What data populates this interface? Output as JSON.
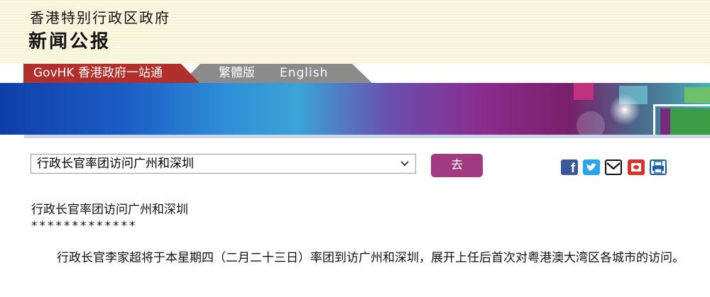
{
  "header": {
    "gov_name": "香港特别行政区政府",
    "bulletin_title": "新闻公报"
  },
  "tabs": {
    "govhk": "GovHK 香港政府一站通",
    "traditional": "繁體版",
    "english": "English"
  },
  "nav_select": {
    "selected": "行政长官率团访问广州和深圳"
  },
  "go_button": {
    "label": "去"
  },
  "share_icons": [
    "facebook-icon",
    "twitter-icon",
    "email-icon",
    "weibo-icon",
    "print-icon"
  ],
  "article": {
    "title": "行政长官率团访问广州和深圳",
    "stars": "*************",
    "paragraph": "行政长官李家超将于本星期四（二月二十三日）率团到访广州和深圳，展开上任后首次对粤港澳大湾区各城市的访问。"
  },
  "colors": {
    "header_bg": "#fbf7df",
    "govhk_tab": "#b2302b",
    "lang_tab": "#8b8b8b",
    "go_button": "#a23a82"
  }
}
